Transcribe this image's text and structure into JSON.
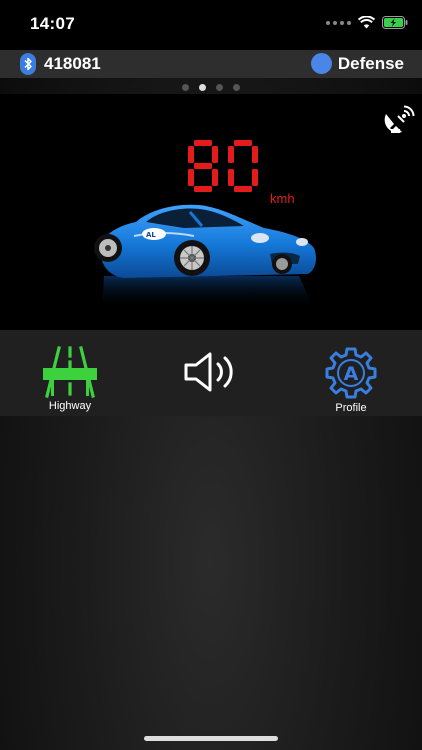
{
  "status_bar": {
    "time": "14:07",
    "icons": [
      "signal-icon",
      "wifi-icon",
      "battery-charging-icon"
    ]
  },
  "header": {
    "bluetooth_icon": "bluetooth-icon",
    "device_id": "418081",
    "mode_label": "Defense",
    "mode_color": "#4a86e8"
  },
  "pager": {
    "page_count": 4,
    "active_index": 1
  },
  "dashboard": {
    "speed": "80",
    "speed_unit": "kmh",
    "speed_color": "#e31b1b",
    "radar_icon": "satellite-dish-icon",
    "car_image": "sports-car-illustration"
  },
  "controls": {
    "highway": {
      "label": "Highway",
      "icon": "highway-icon",
      "color": "#3ed13e"
    },
    "sound": {
      "icon": "speaker-icon"
    },
    "profile": {
      "label": "Profile",
      "icon": "gear-icon",
      "badge": "A",
      "color": "#3a7ee0"
    }
  }
}
